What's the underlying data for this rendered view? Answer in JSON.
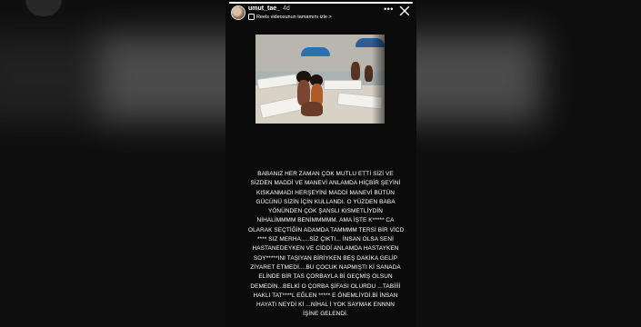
{
  "story": {
    "username": "umut_tae_",
    "time_ago": "4d",
    "reels_link": "Reels videosunun tamamını izle",
    "reels_chevron": ">",
    "more_icon": "more-icon",
    "close_icon": "close-icon",
    "progress": 1.0
  },
  "caption_lines": [
    "BABANIZ HER ZAMAN ÇOK MUTLU ETTİ SİZİ VE",
    "SİZDEN MADDİ VE MANEVİ ANLAMDA HİÇBİR ŞEYİNİ",
    "KISKANMADI HERŞEYİNİ MADDİ MANEVİ BÜTÜN",
    "GÜCÜNÜ SİZİN İÇİN KULLANDI. O YÜZDEN BABA",
    "YÖNÜNDEN ÇOK ŞANSLI KISMETLİYDİN",
    "NİHALİMMMM BENİMMMMM. AMA İŞTE K***** CA",
    "OLARAK SEÇTİĞİN ADAMDA TAMMMM TERSİ BİR VİCD",
    "**** SIZ MERHA.....SİZ ÇIKTI... İNSAN OLSA SENİ",
    "HASTANEDEYKEN VE CİDDİ ANLAMDA HASTAYKEN",
    "SOY*****INI TAŞIYAN BİRİYKEN BEŞ DAKİKA GELİP",
    "ZİYARET ETMEDİ....BU ÇOCUK NAPMIŞTI Kİ SANADA",
    "ELİNDE BİR TAS ÇORBAYLA Bİ GEÇMİŞ OLSUN",
    "DEMEDİN...BELKİ O ÇORBA ŞİFASI OLURDU ...TABİİİİ",
    "HAKLI TAT****L EĞLEN ***** E ÖNEMLİYDİ.Bİ İNSAN",
    "HAYATI NEYDİ Kİ ...NİHAL İ YOK SAYMAK ENNNN",
    "İŞİNE GELENDİ."
  ]
}
